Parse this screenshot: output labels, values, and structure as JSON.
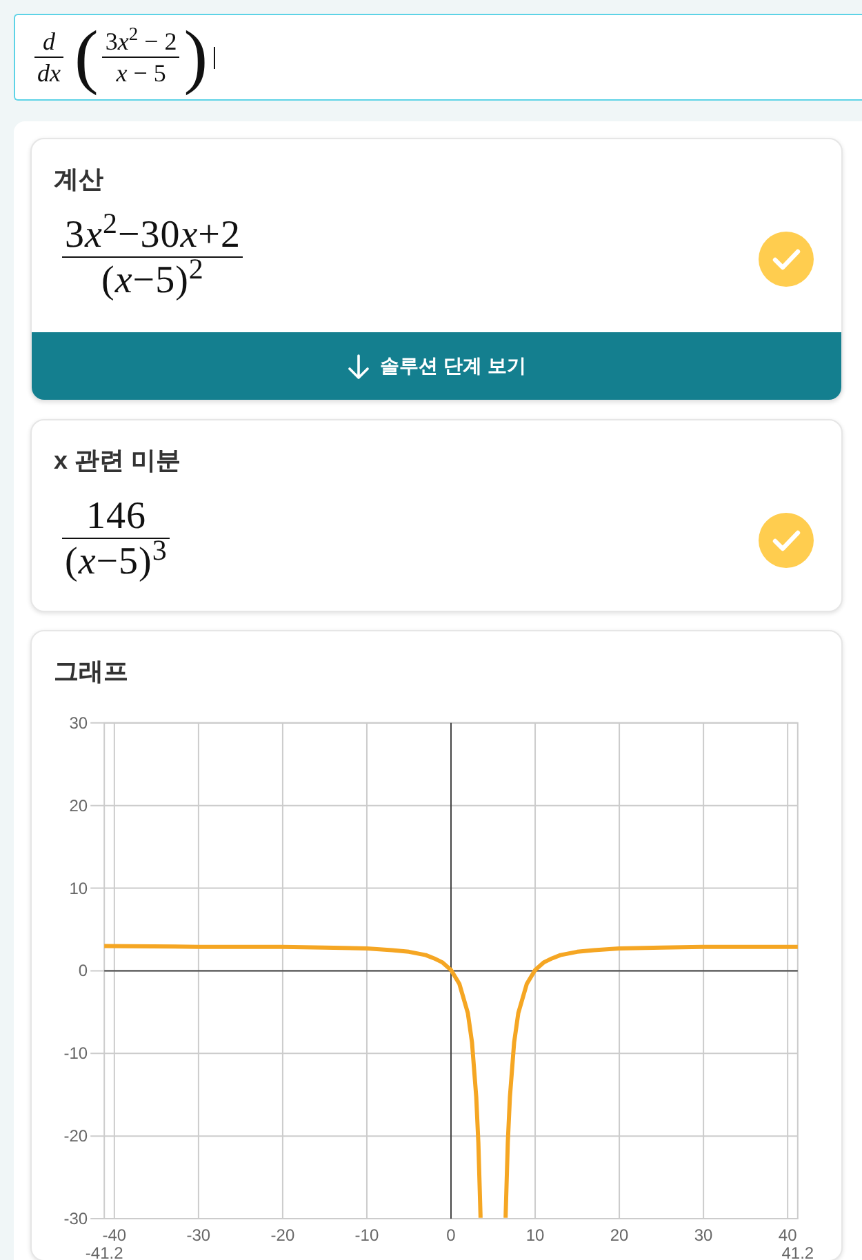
{
  "math_input": {
    "focused": true,
    "operator": {
      "numerator": "d",
      "denominator": "dx"
    },
    "left_paren": "(",
    "fraction": {
      "numerator": "3x$^{2}$ − 2",
      "denominator": "x − 5"
    },
    "right_paren": ")"
  },
  "cards": [
    {
      "kind": "result",
      "title": "계산",
      "result": {
        "numerator": "3x$^{2}$−30x+2",
        "denominator": "(x−5)$^{2}$"
      },
      "verified": true,
      "button": {
        "label": "솔루션 단계 보기"
      }
    },
    {
      "kind": "result",
      "title": "x 관련 미분",
      "result": {
        "numerator": "146",
        "denominator": "(x−5)$^{3}$"
      },
      "verified": true
    },
    {
      "kind": "graph",
      "title": "그래프",
      "chart_data": {
        "type": "line",
        "grid": true,
        "x": [
          -41.2,
          -30,
          -20,
          -15,
          -10,
          -7,
          -5,
          -3,
          -2,
          -1,
          0,
          1,
          2,
          2.5,
          3,
          3.25,
          3.5,
          3.51,
          6.49,
          6.5,
          6.75,
          7,
          7.5,
          8,
          9,
          10,
          11,
          12,
          13,
          15,
          17,
          20,
          25,
          30,
          41.2
        ],
        "series": [
          {
            "color": "#f5a623",
            "values": [
              3,
              2.9,
              2.9,
              2.8,
              2.7,
              2.5,
              2.3,
              1.9,
              1.5,
              1,
              0.1,
              -1.6,
              -5.1,
              -8.7,
              -15.3,
              -20.8,
              -29.4,
              -29.9,
              null,
              null,
              null,
              null,
              null,
              null,
              null,
              null,
              null,
              null,
              null,
              null,
              null,
              null,
              null,
              null,
              null
            ]
          },
          {
            "color": "#f5a623",
            "values": [
              null,
              null,
              null,
              null,
              null,
              null,
              null,
              null,
              null,
              null,
              null,
              null,
              null,
              null,
              null,
              null,
              null,
              null,
              -29.9,
              -29.4,
              -20.8,
              -15.3,
              -8.7,
              -5.1,
              -1.6,
              0.1,
              1,
              1.5,
              1.9,
              2.3,
              2.5,
              2.7,
              2.8,
              2.9,
              2.9
            ]
          }
        ],
        "xlim": [
          -41.2,
          41.2
        ],
        "ylim": [
          -30,
          30
        ],
        "xticks": [
          -40,
          -30,
          -20,
          -10,
          0,
          10,
          20,
          30,
          40
        ],
        "yticks": [
          -30,
          -20,
          -10,
          0,
          10,
          20,
          30
        ],
        "annotations": [
          "-41.2",
          "41.2"
        ]
      }
    }
  ]
}
